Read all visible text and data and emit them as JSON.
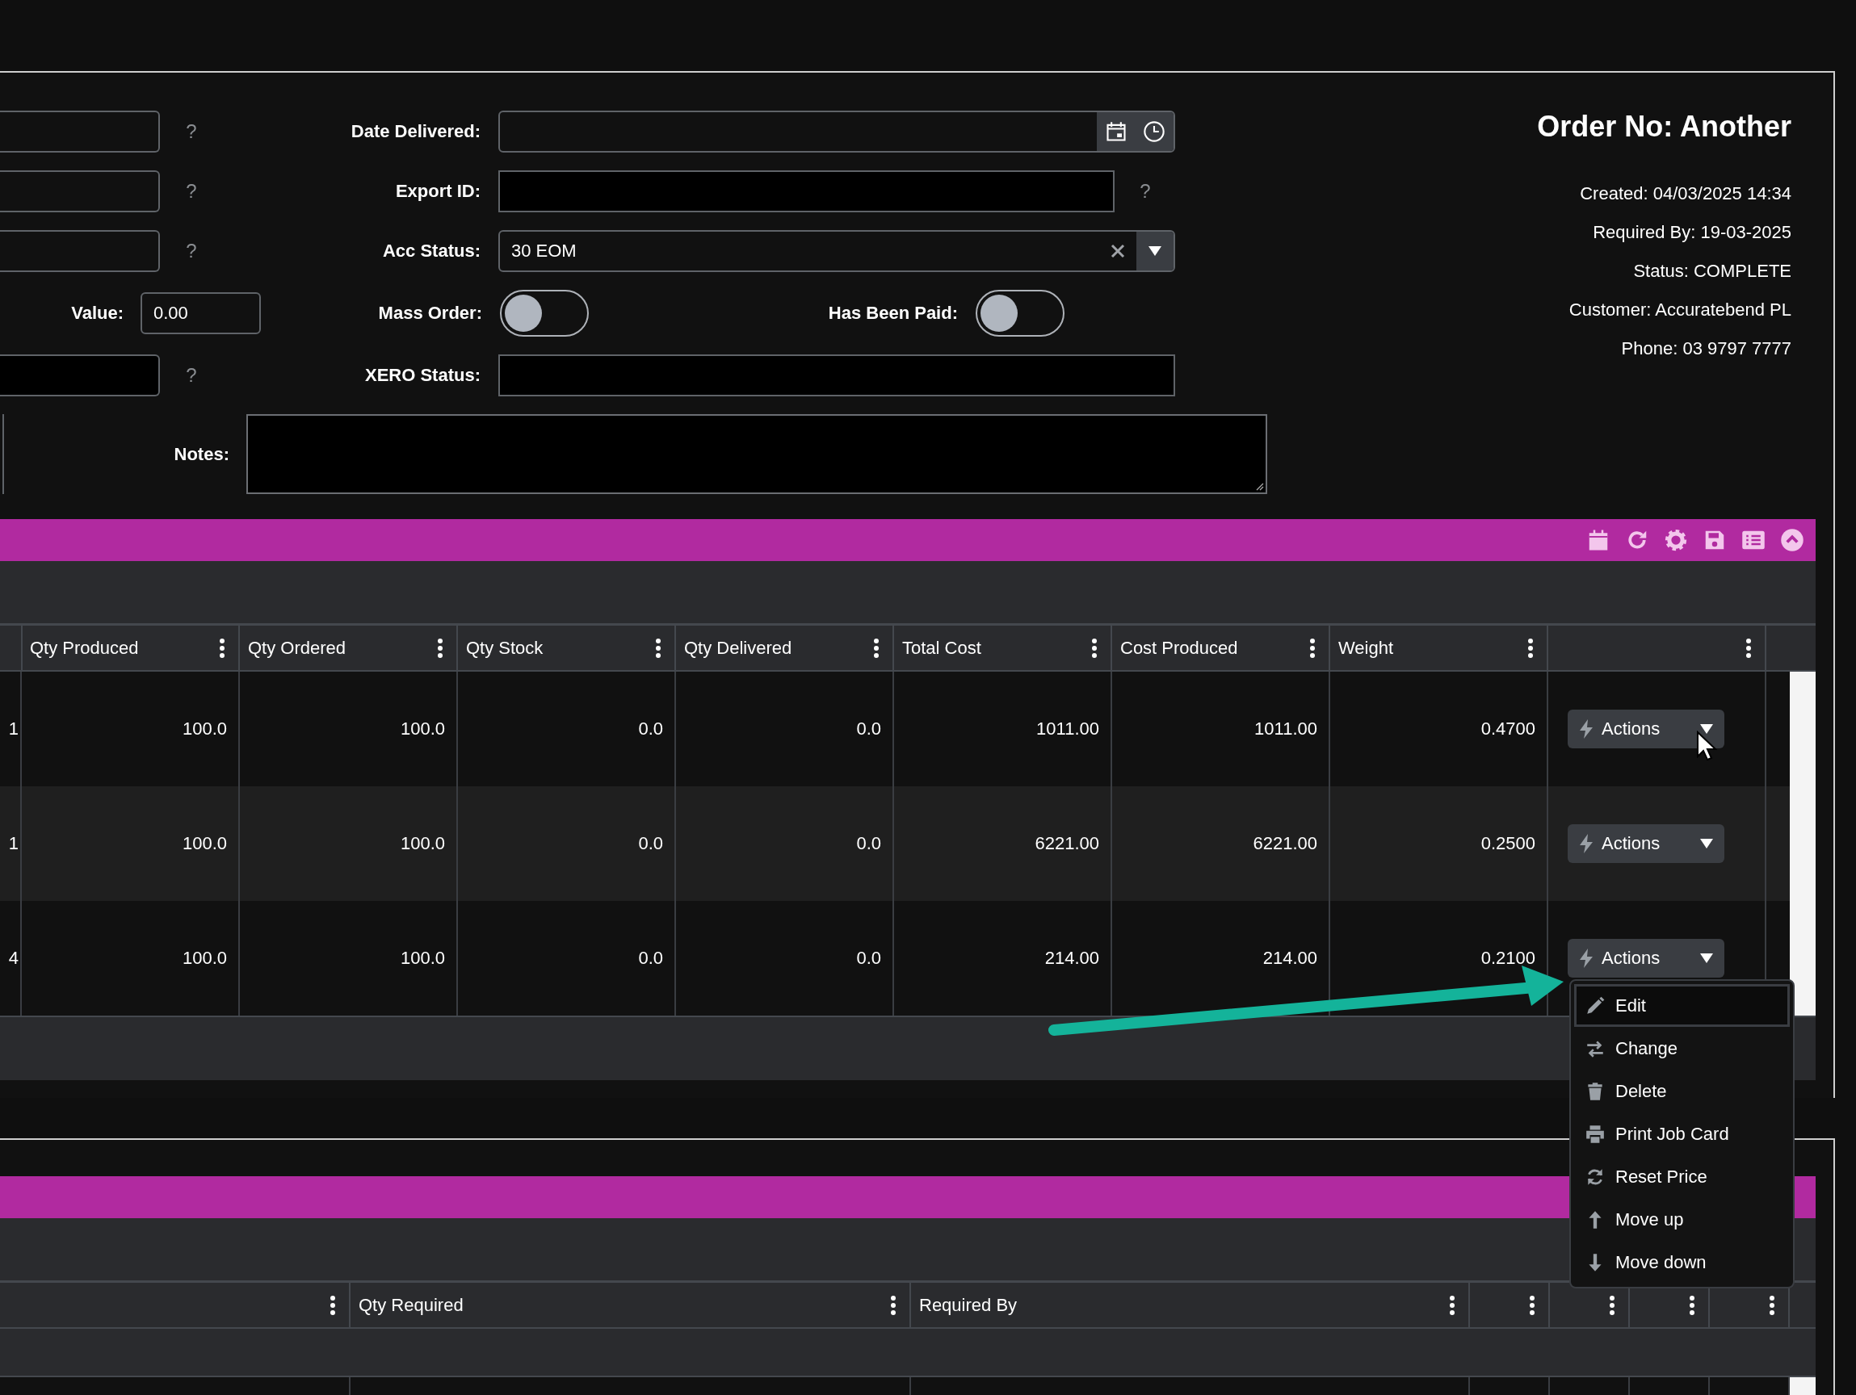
{
  "form": {
    "left_help": [
      "?",
      "?",
      "?",
      "?"
    ],
    "date_delivered": {
      "label": "Date Delivered:"
    },
    "export_id": {
      "label": "Export ID:",
      "help": "?"
    },
    "acc_status": {
      "label": "Acc Status:",
      "value": "30 EOM"
    },
    "value": {
      "label": "Value:",
      "value": "0.00"
    },
    "mass_order": {
      "label": "Mass Order:",
      "on": false
    },
    "has_been_paid": {
      "label": "Has Been Paid:",
      "on": false
    },
    "xero_status": {
      "label": "XERO Status:"
    },
    "notes": {
      "label": "Notes:"
    }
  },
  "order": {
    "title": "Order No: Another",
    "details": [
      "Created: 04/03/2025 14:34",
      "Required By: 19-03-2025",
      "Status: COMPLETE",
      "Customer: Accuratebend PL",
      "Phone: 03 9797 7777"
    ]
  },
  "grid": {
    "columns": [
      {
        "label": "Qty Produced"
      },
      {
        "label": "Qty Ordered"
      },
      {
        "label": "Qty Stock"
      },
      {
        "label": "Qty Delivered"
      },
      {
        "label": "Total Cost"
      },
      {
        "label": "Cost Produced"
      },
      {
        "label": "Weight"
      },
      {}
    ],
    "rows": [
      {
        "cells": [
          "1",
          "100.0",
          "100.0",
          "0.0",
          "0.0",
          "1011.00",
          "1011.00",
          "0.4700"
        ],
        "action": "Actions"
      },
      {
        "cells": [
          "1",
          "100.0",
          "100.0",
          "0.0",
          "0.0",
          "6221.00",
          "6221.00",
          "0.2500"
        ],
        "action": "Actions"
      },
      {
        "cells": [
          "4",
          "100.0",
          "100.0",
          "0.0",
          "0.0",
          "214.00",
          "214.00",
          "0.2100"
        ],
        "action": "Actions"
      }
    ]
  },
  "menu": {
    "items": [
      {
        "kind": "edit",
        "label": "Edit",
        "highlighted": true
      },
      {
        "kind": "change",
        "label": "Change",
        "highlighted": false
      },
      {
        "kind": "delete",
        "label": "Delete",
        "highlighted": false
      },
      {
        "kind": "print",
        "label": "Print Job Card",
        "highlighted": false
      },
      {
        "kind": "reset",
        "label": "Reset Price",
        "highlighted": false
      },
      {
        "kind": "up",
        "label": "Move up",
        "highlighted": false
      },
      {
        "kind": "down",
        "label": "Move down",
        "highlighted": false
      }
    ]
  },
  "grid_2": {
    "columns": [
      {},
      {
        "label": "Qty Required"
      },
      {
        "label": "Required By"
      },
      {},
      {},
      {},
      {}
    ]
  }
}
